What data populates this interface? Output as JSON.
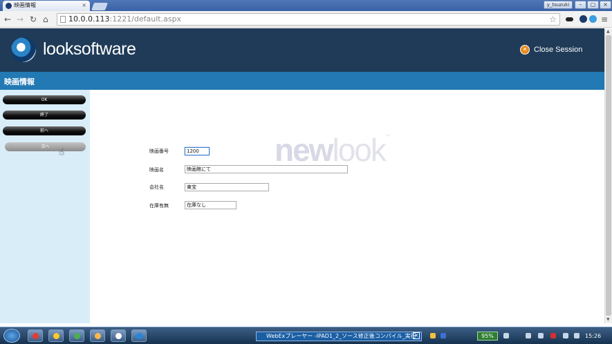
{
  "browser": {
    "tab_title": "映画情報",
    "tab_close": "×",
    "user_label": "y_tsuzuki",
    "window_controls": [
      "–",
      "▢",
      "×"
    ],
    "url_host": "10.0.0.113",
    "url_rest": ":1221/default.aspx",
    "nav_icons": [
      "arrow-left-icon",
      "arrow-right-icon",
      "reload-icon",
      "home-icon"
    ]
  },
  "app": {
    "brand": "looksoftware",
    "close_session": "Close Session",
    "page_title": "映画情報",
    "brand_color": "#1f3b58",
    "accent_color": "#2279b4"
  },
  "sidebar": {
    "buttons": [
      {
        "label": "OK"
      },
      {
        "label": "終了"
      },
      {
        "label": "前へ"
      },
      {
        "label": "次へ"
      }
    ]
  },
  "form": {
    "watermark_bold": "new",
    "watermark_light": "look",
    "watermark_tm": "™",
    "fields": [
      {
        "label": "映画番号",
        "value": "1200"
      },
      {
        "label": "映画名",
        "value": "映画館にて"
      },
      {
        "label": "会社名",
        "value": "東宝"
      },
      {
        "label": "在庫有無",
        "value": "在庫なし"
      }
    ]
  },
  "taskbar": {
    "webex_label": "WebExプレーヤー -IPAD1_2_ソース修正後コンパイル_実行",
    "battery": "95%",
    "clock": "15:26"
  }
}
